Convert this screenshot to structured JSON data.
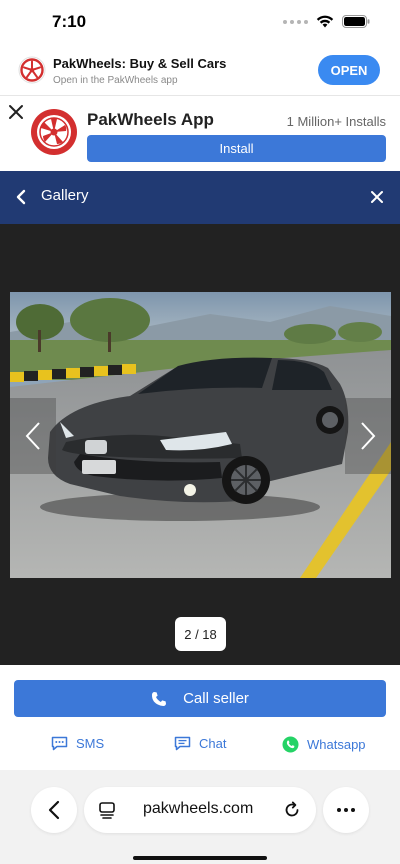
{
  "status_bar": {
    "time": "7:10"
  },
  "smart_banner": {
    "title": "PakWheels: Buy & Sell Cars",
    "subtitle": "Open in the PakWheels app",
    "open_label": "OPEN"
  },
  "app_promo": {
    "title": "PakWheels App",
    "installs": "1 Million+ Installs",
    "install_label": "Install"
  },
  "gallery": {
    "title": "Gallery",
    "counter": "2 / 18"
  },
  "contact": {
    "call_label": "Call seller",
    "sms_label": "SMS",
    "chat_label": "Chat",
    "whatsapp_label": "Whatsapp"
  },
  "browser": {
    "url": "pakwheels.com"
  },
  "colors": {
    "brand_blue": "#3c78d8",
    "header_navy": "#213a73",
    "brand_red": "#d32f2f",
    "whatsapp_green": "#25d366"
  }
}
